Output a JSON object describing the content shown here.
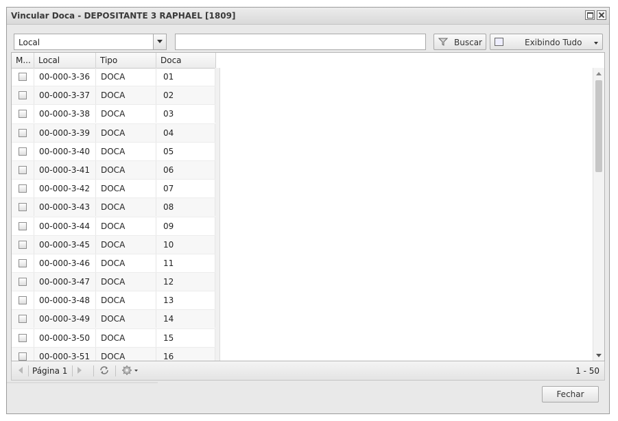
{
  "window": {
    "title": "Vincular Doca - DEPOSITANTE 3 RAPHAEL [1809]"
  },
  "toolbar": {
    "field_select": "Local",
    "search_value": "",
    "search_button": "Buscar",
    "filter_button": "Exibindo Tudo"
  },
  "grid": {
    "columns": [
      "M...",
      "Local",
      "Tipo",
      "Doca"
    ],
    "rows": [
      {
        "local": "00-000-3-36",
        "tipo": "DOCA",
        "doca": "01"
      },
      {
        "local": "00-000-3-37",
        "tipo": "DOCA",
        "doca": "02"
      },
      {
        "local": "00-000-3-38",
        "tipo": "DOCA",
        "doca": "03"
      },
      {
        "local": "00-000-3-39",
        "tipo": "DOCA",
        "doca": "04"
      },
      {
        "local": "00-000-3-40",
        "tipo": "DOCA",
        "doca": "05"
      },
      {
        "local": "00-000-3-41",
        "tipo": "DOCA",
        "doca": "06"
      },
      {
        "local": "00-000-3-42",
        "tipo": "DOCA",
        "doca": "07"
      },
      {
        "local": "00-000-3-43",
        "tipo": "DOCA",
        "doca": "08"
      },
      {
        "local": "00-000-3-44",
        "tipo": "DOCA",
        "doca": "09"
      },
      {
        "local": "00-000-3-45",
        "tipo": "DOCA",
        "doca": "10"
      },
      {
        "local": "00-000-3-46",
        "tipo": "DOCA",
        "doca": "11"
      },
      {
        "local": "00-000-3-47",
        "tipo": "DOCA",
        "doca": "12"
      },
      {
        "local": "00-000-3-48",
        "tipo": "DOCA",
        "doca": "13"
      },
      {
        "local": "00-000-3-49",
        "tipo": "DOCA",
        "doca": "14"
      },
      {
        "local": "00-000-3-50",
        "tipo": "DOCA",
        "doca": "15"
      },
      {
        "local": "00-000-3-51",
        "tipo": "DOCA",
        "doca": "16"
      }
    ]
  },
  "pager": {
    "page_label": "Página 1",
    "count": "1 - 50"
  },
  "footer": {
    "close_button": "Fechar"
  },
  "icons": {
    "maximize": "maximize-icon",
    "close": "close-icon",
    "filter": "funnel-icon",
    "view": "view-icon",
    "refresh": "refresh-icon",
    "settings": "gear-icon",
    "first": "first-page-icon",
    "next": "next-page-icon"
  }
}
